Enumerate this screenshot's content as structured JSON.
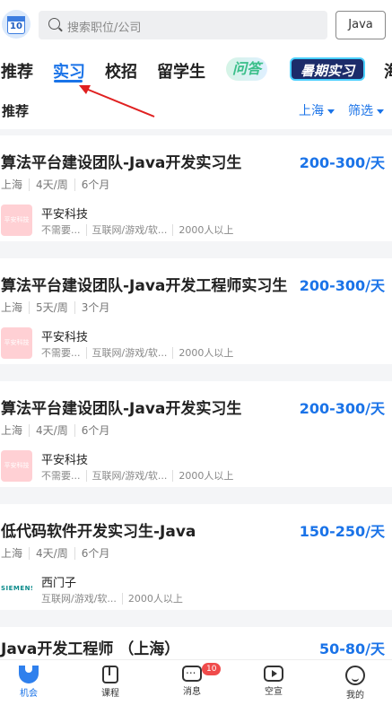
{
  "header": {
    "avatar_text": "10",
    "search_placeholder": "搜索职位/公司",
    "java_button": "Java"
  },
  "tabs": {
    "items": [
      "推荐",
      "实习",
      "校招",
      "留学生"
    ],
    "wenda": "问答",
    "shuqi": "暑期实习",
    "more": "海"
  },
  "filter": {
    "title": "推荐",
    "city": "上海",
    "screen": "筛选"
  },
  "jobs": [
    {
      "title": "算法平台建设团队-Java开发实习生",
      "salary": "200-300/天",
      "city": "上海",
      "days": "4天/周",
      "months": "6个月",
      "logo": "平安科技",
      "company": "平安科技",
      "funding": "不需要...",
      "industry": "互联网/游戏/软...",
      "size": "2000人以上"
    },
    {
      "title": "算法平台建设团队-Java开发工程师实习生",
      "salary": "200-300/天",
      "city": "上海",
      "days": "5天/周",
      "months": "3个月",
      "logo": "平安科技",
      "company": "平安科技",
      "funding": "不需要...",
      "industry": "互联网/游戏/软...",
      "size": "2000人以上"
    },
    {
      "title": "算法平台建设团队-Java开发实习生",
      "salary": "200-300/天",
      "city": "上海",
      "days": "4天/周",
      "months": "6个月",
      "logo": "平安科技",
      "company": "平安科技",
      "funding": "不需要...",
      "industry": "互联网/游戏/软...",
      "size": "2000人以上"
    },
    {
      "title": "低代码软件开发实习生-Java",
      "salary": "150-250/天",
      "city": "上海",
      "days": "4天/周",
      "months": "6个月",
      "logo": "SIEMENS",
      "company": "西门子",
      "industry": "互联网/游戏/软...",
      "size": "2000人以上"
    },
    {
      "title": "Java开发工程师 （上海）",
      "salary": "50-80/天"
    }
  ],
  "nav": {
    "items": [
      "机会",
      "课程",
      "消息",
      "空宣",
      "我的"
    ],
    "message_badge": "10"
  },
  "colors": {
    "accent": "#1a73e8",
    "annotation_arrow": "#e02020"
  }
}
